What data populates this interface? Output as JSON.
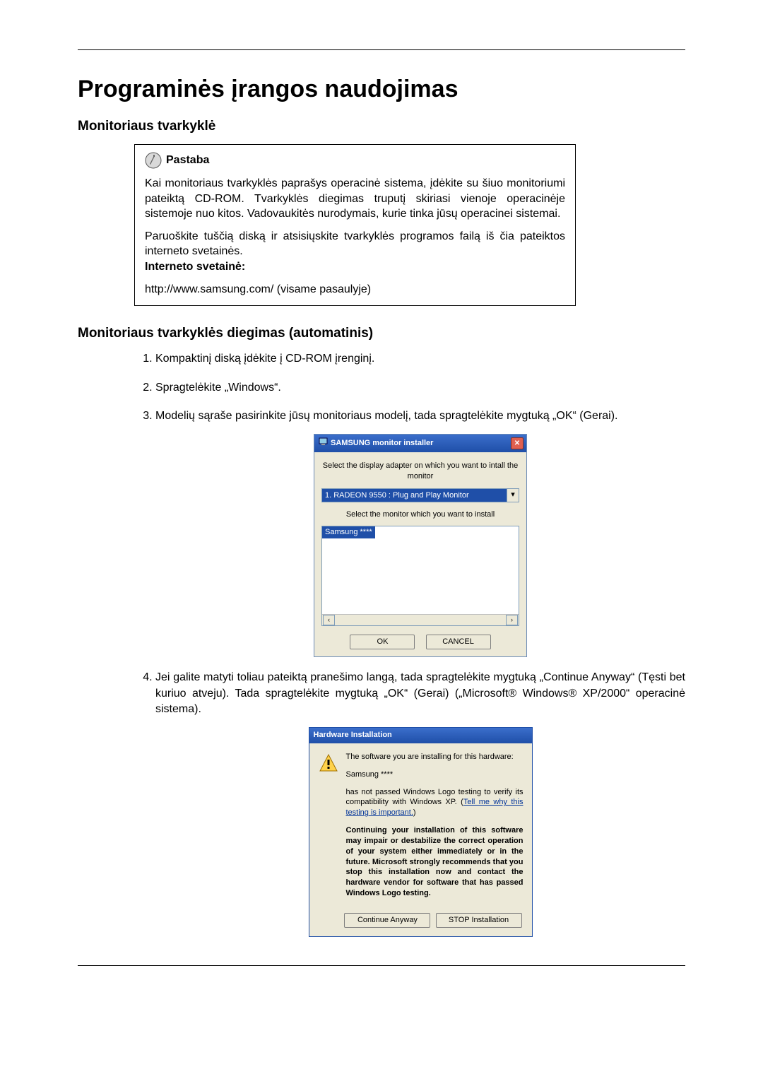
{
  "title": "Programinės įrangos naudojimas",
  "section1": {
    "heading": "Monitoriaus tvarkyklė",
    "note_label": "Pastaba",
    "para1": "Kai monitoriaus tvarkyklės paprašys operacinė sistema, įdėkite su šiuo monitoriumi pateiktą CD-ROM. Tvarkyklės diegimas truputį skiriasi vienoje operacinėje sistemoje nuo kitos. Vadovaukitės nurodymais, kurie tinka jūsų operacinei sistemai.",
    "para2": "Paruoškite tuščią diską ir atsisiųskite tvarkyklės programos failą iš čia pateiktos interneto svetainės.",
    "internet_label": "Interneto svetainė:",
    "internet_url": "http://www.samsung.com/ (visame pasaulyje)"
  },
  "section2": {
    "heading": "Monitoriaus tvarkyklės diegimas (automatinis)",
    "steps": [
      "Kompaktinį diską įdėkite į CD-ROM įrenginį.",
      "Spragtelėkite „Windows“.",
      "Modelių sąraše pasirinkite jūsų monitoriaus modelį, tada spragtelėkite mygtuką „OK“ (Gerai).",
      "Jei galite matyti toliau pateiktą pranešimo langą, tada spragtelėkite mygtuką „Continue Anyway“ (Tęsti bet kuriuo atveju). Tada spragtelėkite mygtuką „OK“ (Gerai) („Microsoft® Windows® XP/2000“ operacinė sistema)."
    ]
  },
  "installer_dialog": {
    "title": "SAMSUNG monitor installer",
    "line1": "Select the display adapter on which you want to intall the monitor",
    "adapter": "1. RADEON 9550 : Plug and Play Monitor",
    "line2": "Select the monitor which you want to install",
    "model": "Samsung ****",
    "ok": "OK",
    "cancel": "CANCEL"
  },
  "hw_dialog": {
    "title": "Hardware Installation",
    "p1": "The software you are installing for this hardware:",
    "p2": "Samsung ****",
    "p3a": "has not passed Windows Logo testing to verify its compatibility with Windows XP. (",
    "p3link": "Tell me why this testing is important.",
    "p3b": ")",
    "p4": "Continuing your installation of this software may impair or destabilize the correct operation of your system either immediately or in the future. Microsoft strongly recommends that you stop this installation now and contact the hardware vendor for software that has passed Windows Logo testing.",
    "btn_continue": "Continue Anyway",
    "btn_stop": "STOP Installation"
  }
}
